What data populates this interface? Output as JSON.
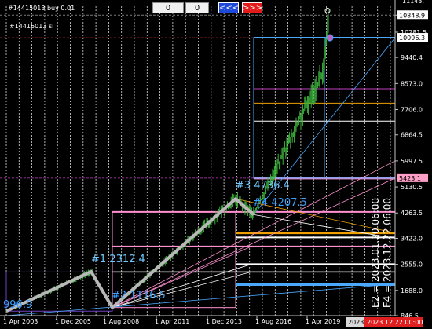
{
  "header": {
    "info_line": "#14415013 buy 0.01",
    "sl_label": "#14415013 sl",
    "buttons": [
      "0",
      "0"
    ],
    "nav_prev": "<<<",
    "nav_next": ">>>"
  },
  "price_axis": {
    "top_clip": "11143.",
    "labels": [
      "10848.9",
      "10281.5",
      "9440.4",
      "8573.0",
      "7706.0",
      "6864.5",
      "5997.5",
      "5130.5",
      "4263.5",
      "3422.0",
      "2555.0",
      "1688.0",
      "846.5"
    ],
    "boxes": [
      {
        "text": "10848.9",
        "bg": "#ffffff",
        "fg": "#000000"
      },
      {
        "text": "10096.3",
        "bg": "#ffffff",
        "fg": "#000000"
      },
      {
        "text": "5423.1",
        "bg": "#ff9ec6",
        "fg": "#000000"
      }
    ]
  },
  "time_axis": {
    "labels": [
      "1 Apr 2003",
      "1 Dec 2005",
      "1 Aug 2008",
      "1 Apr 2011",
      "1 Dec 2013",
      "1 Aug 2016",
      "1 Apr 2019"
    ],
    "box1": "2023",
    "box2": "2023.12.22 00:00"
  },
  "annotations": {
    "p0": "996.9",
    "p1": "#1 2312.4",
    "p2": "#2 1116.5",
    "p3": "#3 4736.4",
    "p4": "#4 4207.5",
    "e2": "E2 = 2023.01.20 06:00",
    "e4": "E4 = 2023.12.22 06:00"
  },
  "chart_data": {
    "type": "line",
    "ylim": [
      846.5,
      11143
    ],
    "yticks": [
      10848.9,
      10281.5,
      9440.4,
      8573.0,
      7706.0,
      6864.5,
      5997.5,
      5130.5,
      4263.5,
      3422.0,
      2555.0,
      1688.0,
      846.5
    ],
    "x": [
      "2003-04-01",
      "2005-12-01",
      "2008-08-01",
      "2011-04-01",
      "2013-12-01",
      "2016-08-01",
      "2019-04-01"
    ],
    "zigzag": [
      {
        "label": "0",
        "value": 996.9
      },
      {
        "label": "#1",
        "value": 2312.4
      },
      {
        "label": "#2",
        "value": 1116.5
      },
      {
        "label": "#3",
        "value": 4736.4
      },
      {
        "label": "#4",
        "value": 4207.5
      }
    ],
    "colors": {
      "bullish": "#3cb43c",
      "zigzag": "#b8b8b8",
      "pink": "#ff8ad8",
      "orange": "#f0a000",
      "blue": "#4a90f0"
    }
  }
}
